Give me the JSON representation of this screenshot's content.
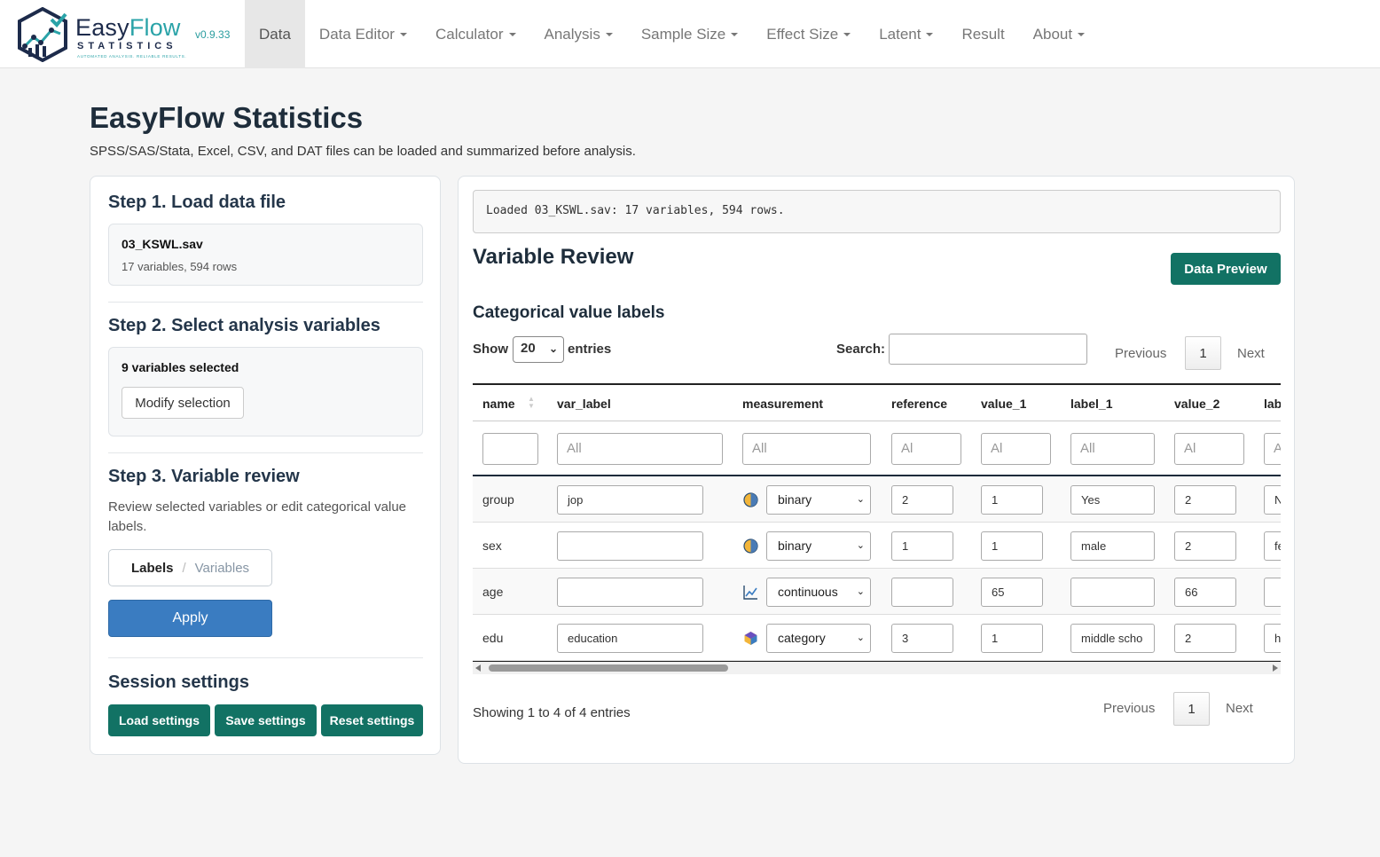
{
  "brand": {
    "name_part1": "Easy",
    "name_part2": "Flow",
    "sub": "STATISTICS",
    "tagline": "AUTOMATED ANALYSIS. RELIABLE RESULTS.",
    "version": "v0.9.33"
  },
  "nav": {
    "items": [
      {
        "label": "Data",
        "active": true,
        "dropdown": false
      },
      {
        "label": "Data Editor",
        "dropdown": true
      },
      {
        "label": "Calculator",
        "dropdown": true
      },
      {
        "label": "Analysis",
        "dropdown": true
      },
      {
        "label": "Sample Size",
        "dropdown": true
      },
      {
        "label": "Effect Size",
        "dropdown": true
      },
      {
        "label": "Latent",
        "dropdown": true
      },
      {
        "label": "Result",
        "dropdown": false
      },
      {
        "label": "About",
        "dropdown": true
      }
    ]
  },
  "page": {
    "title": "EasyFlow Statistics",
    "subtitle": "SPSS/SAS/Stata, Excel, CSV, and DAT files can be loaded and summarized before analysis."
  },
  "left": {
    "step1_title": "Step 1. Load data file",
    "file_name": "03_KSWL.sav",
    "file_info": "17 variables, 594 rows",
    "step2_title": "Step 2. Select analysis variables",
    "selected_count": "9 variables selected",
    "modify_label": "Modify selection",
    "step3_title": "Step 3. Variable review",
    "step3_desc": "Review selected variables or edit categorical value labels.",
    "toggle_on": "Labels",
    "toggle_sep": "/",
    "toggle_off": "Variables",
    "apply_label": "Apply",
    "session_title": "Session settings",
    "load_settings": "Load settings",
    "save_settings": "Save settings",
    "reset_settings": "Reset settings"
  },
  "right": {
    "loaded_message": "Loaded 03_KSWL.sav: 17 variables, 594 rows.",
    "section_title": "Variable Review",
    "preview_label": "Data Preview",
    "sub_title": "Categorical value labels",
    "show_label": "Show",
    "page_length": "20",
    "entries_label": "entries",
    "search_label": "Search:",
    "search_value": "",
    "prev_label": "Previous",
    "next_label": "Next",
    "page_num": "1",
    "info": "Showing 1 to 4 of 4 entries"
  },
  "table": {
    "columns": [
      "name",
      "var_label",
      "measurement",
      "reference",
      "value_1",
      "label_1",
      "value_2",
      "lab"
    ],
    "filters": [
      "",
      "All",
      "All",
      "Al",
      "Al",
      "All",
      "Al",
      "A"
    ],
    "rows": [
      {
        "name": "group",
        "var_label": "jop",
        "measurement": "binary",
        "icon": "binary-icon",
        "reference": "2",
        "value_1": "1",
        "label_1": "Yes",
        "value_2": "2",
        "label_2": "N"
      },
      {
        "name": "sex",
        "var_label": "",
        "measurement": "binary",
        "icon": "binary-icon",
        "reference": "1",
        "value_1": "1",
        "label_1": "male",
        "value_2": "2",
        "label_2": "fe"
      },
      {
        "name": "age",
        "var_label": "",
        "measurement": "continuous",
        "icon": "continuous-icon",
        "reference": "",
        "value_1": "65",
        "label_1": "",
        "value_2": "66",
        "label_2": ""
      },
      {
        "name": "edu",
        "var_label": "education",
        "measurement": "category",
        "icon": "category-icon",
        "reference": "3",
        "value_1": "1",
        "label_1": "middle scho",
        "value_2": "2",
        "label_2": "h"
      }
    ]
  },
  "colors": {
    "primary_teal": "#127264",
    "apply_blue": "#3a7cc1",
    "brand_navy": "#1d2b4b",
    "brand_teal": "#2aa3a8"
  }
}
